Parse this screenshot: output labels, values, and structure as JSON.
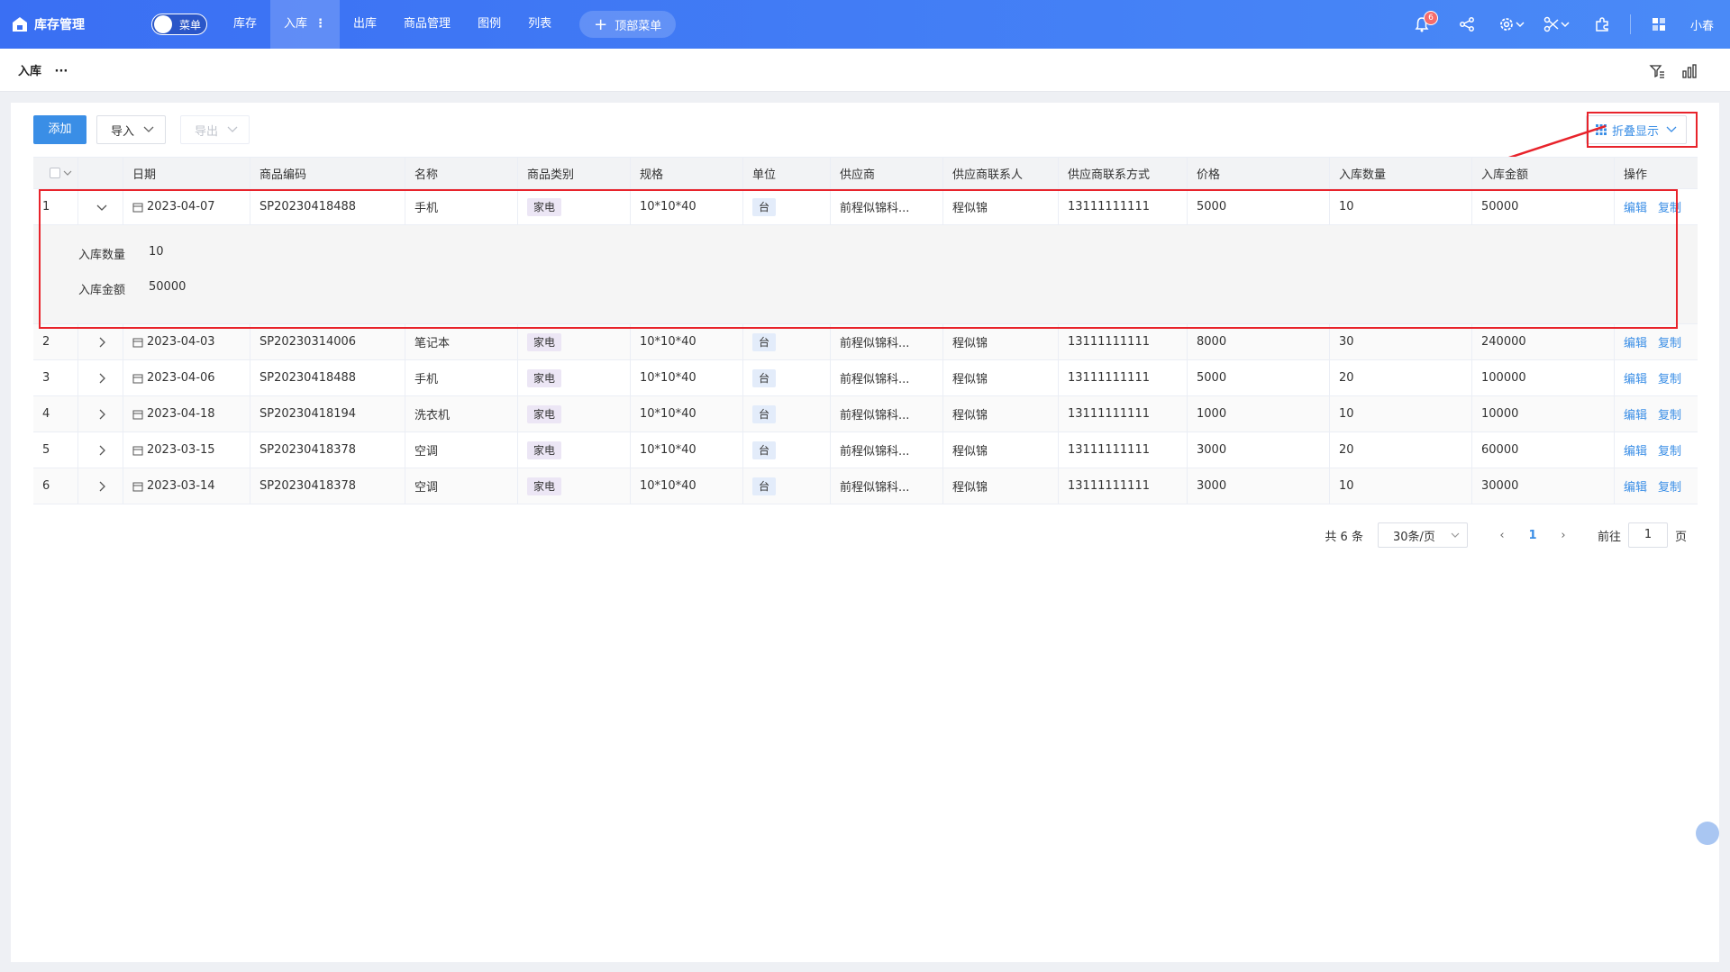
{
  "app": {
    "title": "库存管理"
  },
  "menu_toggle": {
    "label": "菜单"
  },
  "nav": [
    {
      "label": "库存"
    },
    {
      "label": "入库",
      "active": true
    },
    {
      "label": "出库"
    },
    {
      "label": "商品管理"
    },
    {
      "label": "图例"
    },
    {
      "label": "列表"
    }
  ],
  "top_menu_button": {
    "label": "顶部菜单"
  },
  "header_right": {
    "notification_count": "6",
    "user_name": "小春"
  },
  "breadcrumb": {
    "current": "入库",
    "more": "···"
  },
  "toolbar": {
    "add_label": "添加",
    "import_label": "导入",
    "export_label": "导出",
    "fold_label": "折叠显示"
  },
  "table": {
    "columns": [
      "日期",
      "商品编码",
      "名称",
      "商品类别",
      "规格",
      "单位",
      "供应商",
      "供应商联系人",
      "供应商联系方式",
      "价格",
      "入库数量",
      "入库金额",
      "操作"
    ],
    "rows": [
      {
        "index": "1",
        "date": "2023-04-07",
        "code": "SP20230418488",
        "name": "手机",
        "category": "家电",
        "spec": "10*10*40",
        "unit": "台",
        "supplier": "前程似锦科...",
        "contact": "程似锦",
        "phone": "13111111111",
        "price": "5000",
        "qty": "10",
        "amount": "50000",
        "expanded": true
      },
      {
        "index": "2",
        "date": "2023-04-03",
        "code": "SP20230314006",
        "name": "笔记本",
        "category": "家电",
        "spec": "10*10*40",
        "unit": "台",
        "supplier": "前程似锦科...",
        "contact": "程似锦",
        "phone": "13111111111",
        "price": "8000",
        "qty": "30",
        "amount": "240000"
      },
      {
        "index": "3",
        "date": "2023-04-06",
        "code": "SP20230418488",
        "name": "手机",
        "category": "家电",
        "spec": "10*10*40",
        "unit": "台",
        "supplier": "前程似锦科...",
        "contact": "程似锦",
        "phone": "13111111111",
        "price": "5000",
        "qty": "20",
        "amount": "100000"
      },
      {
        "index": "4",
        "date": "2023-04-18",
        "code": "SP20230418194",
        "name": "洗衣机",
        "category": "家电",
        "spec": "10*10*40",
        "unit": "台",
        "supplier": "前程似锦科...",
        "contact": "程似锦",
        "phone": "13111111111",
        "price": "1000",
        "qty": "10",
        "amount": "10000"
      },
      {
        "index": "5",
        "date": "2023-03-15",
        "code": "SP20230418378",
        "name": "空调",
        "category": "家电",
        "spec": "10*10*40",
        "unit": "台",
        "supplier": "前程似锦科...",
        "contact": "程似锦",
        "phone": "13111111111",
        "price": "3000",
        "qty": "20",
        "amount": "60000"
      },
      {
        "index": "6",
        "date": "2023-03-14",
        "code": "SP20230418378",
        "name": "空调",
        "category": "家电",
        "spec": "10*10*40",
        "unit": "台",
        "supplier": "前程似锦科...",
        "contact": "程似锦",
        "phone": "13111111111",
        "price": "3000",
        "qty": "10",
        "amount": "30000"
      }
    ],
    "actions": {
      "edit": "编辑",
      "copy": "复制"
    },
    "expanded_detail": [
      {
        "label": "入库数量",
        "value": "10"
      },
      {
        "label": "入库金额",
        "value": "50000"
      }
    ]
  },
  "pagination": {
    "total": "共 6 条",
    "page_size": "30条/页",
    "current_page": "1",
    "goto_label": "前往",
    "goto_value": "1",
    "page_suffix": "页"
  },
  "colors": {
    "header": "#3a6ff3",
    "primary": "#3a8ee6",
    "highlight": "#e8232b"
  }
}
